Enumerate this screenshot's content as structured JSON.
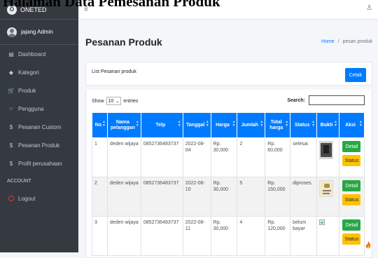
{
  "overlay_title": "Halaman Data Pemesanan Produk",
  "brand": {
    "logo_letter": "O",
    "name": "ONETED"
  },
  "user": {
    "name": "jajang Admin"
  },
  "sidebar": {
    "items": [
      {
        "icon": "▤",
        "label": "Dashboard"
      },
      {
        "icon": "◆",
        "label": "Kategori"
      },
      {
        "icon": "🛒",
        "label": "Produk"
      },
      {
        "icon": "☞",
        "label": "Pengguna"
      },
      {
        "icon": "$",
        "label": "Pesanan Custom"
      },
      {
        "icon": "$",
        "label": "Pesanan Produk"
      },
      {
        "icon": "$",
        "label": "Profil perusahaan"
      }
    ],
    "section_header": "ACCOUNT",
    "logout_label": "Logout"
  },
  "topbar": {
    "menu_icon": "≡",
    "user_icon": "♙"
  },
  "header": {
    "title": "Pesanan Produk"
  },
  "breadcrumb": {
    "home": "Home",
    "sep": "/",
    "current": "pesan produk"
  },
  "card": {
    "title": "List Pesanan produk",
    "print_label": "Cetak"
  },
  "table_controls": {
    "show_label": "Show",
    "entries_value": "10",
    "entries_label": "entries",
    "search_label": "Search:"
  },
  "table": {
    "columns": [
      "No",
      "Nama pelanggan",
      "Telp",
      "Tanggal",
      "Harga",
      "Jumlah",
      "Total harga",
      "Status",
      "Bukti",
      "Aksi"
    ],
    "rows": [
      {
        "no": "1",
        "name": "deden wijaya",
        "telp": "0852736483737",
        "date": "2022-08-04",
        "price": "Rp. 30,000",
        "qty": "2",
        "total": "Rp. 60,000",
        "status": "selesai",
        "proof": "image"
      },
      {
        "no": "2",
        "name": "deden wijaya",
        "telp": "0852736483737",
        "date": "2022-08-10",
        "price": "Rp. 30,000",
        "qty": "5",
        "total": "Rp. 150,000",
        "status": "diproses.",
        "proof": "image"
      },
      {
        "no": "3",
        "name": "deden wijaya",
        "telp": "0852736483737",
        "date": "2022-08-11",
        "price": "Rp. 30,000",
        "qty": "4",
        "total": "Rp. 120,000",
        "status": "belum bayar",
        "proof": "broken-image"
      }
    ],
    "detail_label": "Detail",
    "status_label": "Status"
  },
  "colors": {
    "sidebar": "#343a40",
    "primary": "#007bff",
    "success": "#28a745",
    "warning": "#ffc107"
  }
}
